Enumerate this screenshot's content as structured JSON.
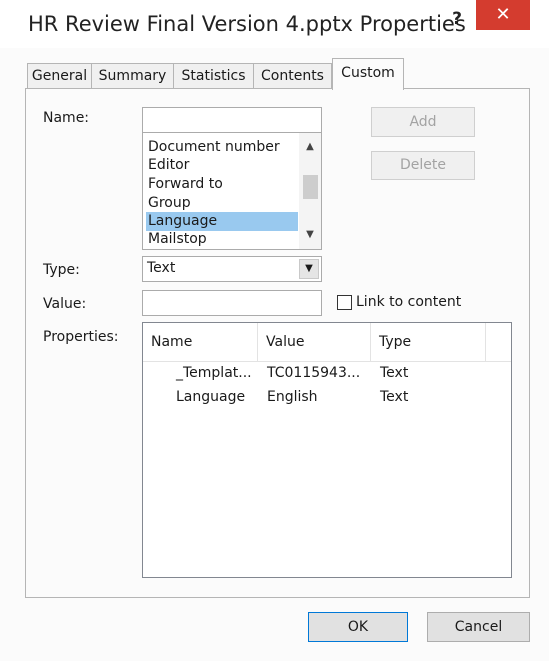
{
  "window": {
    "title": "HR Review Final Version 4.pptx Properties",
    "help_label": "?",
    "close_label": "✕"
  },
  "tabs": [
    {
      "label": "General",
      "active": false
    },
    {
      "label": "Summary",
      "active": false
    },
    {
      "label": "Statistics",
      "active": false
    },
    {
      "label": "Contents",
      "active": false
    },
    {
      "label": "Custom",
      "active": true
    }
  ],
  "custom": {
    "name_label": "Name:",
    "name_value": "",
    "name_list": [
      "Document number",
      "Editor",
      "Forward to",
      "Group",
      "Language",
      "Mailstop"
    ],
    "selected_item": "Language",
    "add_label": "Add",
    "delete_label": "Delete",
    "type_label": "Type:",
    "type_value": "Text",
    "value_label": "Value:",
    "value_value": "",
    "link_label": "Link to content",
    "link_checked": false,
    "properties_label": "Properties:",
    "properties_columns": [
      "Name",
      "Value",
      "Type"
    ],
    "properties_rows": [
      {
        "name": "_Templat...",
        "value": "TC0115943...",
        "type": "Text"
      },
      {
        "name": "Language",
        "value": "English",
        "type": "Text"
      }
    ]
  },
  "footer": {
    "ok_label": "OK",
    "cancel_label": "Cancel"
  },
  "colors": {
    "close_button": "#d43c2f",
    "selection": "#99c9ef",
    "ok_border": "#0078d7"
  },
  "icons": {
    "list_scroll_up": "chevron-up-icon",
    "list_scroll_down": "chevron-down-icon",
    "type_dropdown": "chevron-down-icon"
  }
}
